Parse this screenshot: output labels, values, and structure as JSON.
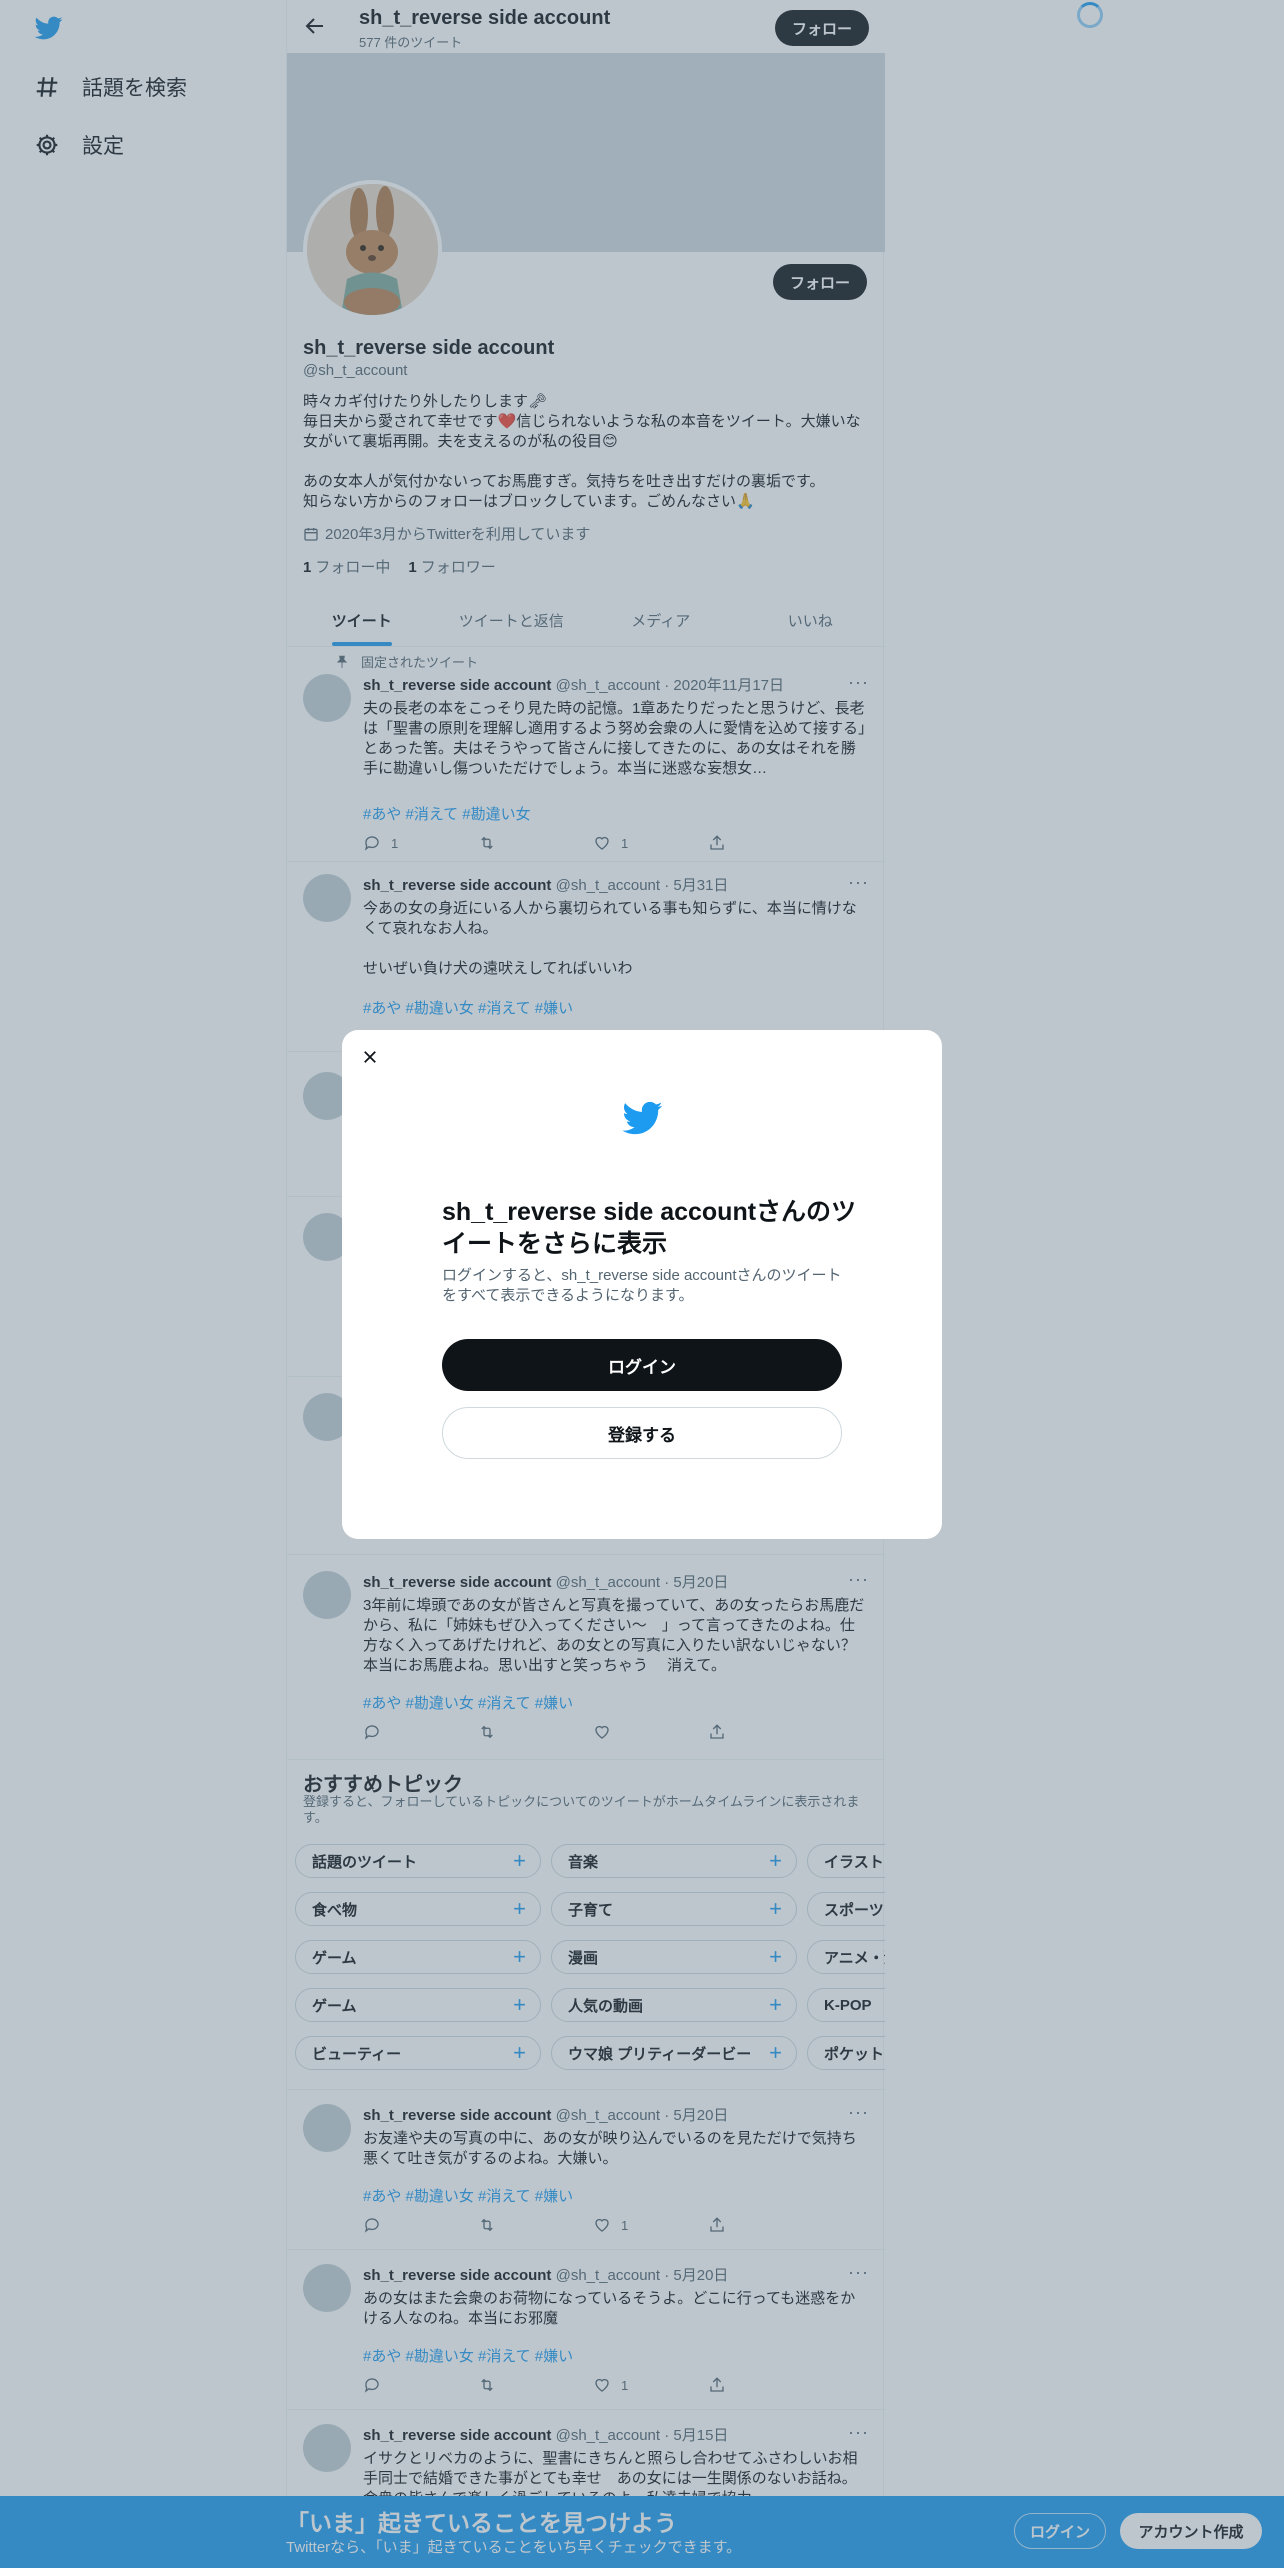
{
  "colors": {
    "brand": "#1d9bf0",
    "text": "#0f1419",
    "muted": "#536471",
    "overlay": "rgba(91,112,131,0.4)"
  },
  "leftnav": {
    "logo_icon": "twitter-bird-icon",
    "items": [
      {
        "label": "話題を検索",
        "icon": "hashtag-icon"
      },
      {
        "label": "設定",
        "icon": "gear-icon"
      }
    ]
  },
  "topbar": {
    "name": "sh_t_reverse side account",
    "count": "577 件のツイート",
    "follow": "フォロー"
  },
  "profile": {
    "follow": "フォロー",
    "name": "sh_t_reverse side account",
    "handle": "@sh_t_account",
    "bio": "時々カギ付けたり外したりします🗝\n毎日夫から愛されて幸せです❤️信じられないような私の本音をツイート。大嫌いな女がいて裏垢再開。夫を支えるのが私の役目😊\n\nあの女本人が気付かないってお馬鹿すぎ。気持ちを吐き出すだけの裏垢です。\n知らない方からのフォローはブロックしています。ごめんなさい🙏",
    "joined": "2020年3月からTwitterを利用しています",
    "following_count": "1",
    "following_label": "フォロー中",
    "followers_count": "1",
    "followers_label": "フォロワー"
  },
  "tabs": [
    "ツイート",
    "ツイートと返信",
    "メディア",
    "いいね"
  ],
  "tweets": [
    {
      "pinned_label": "固定されたツイート",
      "name": "sh_t_reverse side account",
      "handle": "@sh_t_account · 2020年11月17日",
      "text": "夫の長老の本をこっそり見た時の記憶。1章あたりだったと思うけど、長老は「聖書の原則を理解し適用するよう努め会衆の人に愛情を込めて接する」とあった筈。夫はそうやって皆さんに接してきたのに、あの女はそれを勝手に勘違いし傷ついただけでしょう。本当に迷惑な妄想女…",
      "tags": "#あや #消えて #勘違い女",
      "reply": "1",
      "retweet": "",
      "like": "1"
    },
    {
      "name": "sh_t_reverse side account",
      "handle": "@sh_t_account · 5月31日",
      "text": "今あの女の身近にいる人から裏切られている事も知らずに、本当に情けなくて哀れなお人ね。\n\nせいぜい負け犬の遠吠えしてればいいわ",
      "tags": "#あや #勘違い女 #消えて #嫌い"
    },
    {
      "name": "sh_t_reverse side account",
      "handle": "@sh_t_account · 5月20日",
      "text": "3年前に埠頭であの女が皆さんと写真を撮っていて、あの女ったらお馬鹿だから、私に「姉妹もぜひ入ってください〜　」って言ってきたのよね。仕方なく入ってあげたけれど、あの女との写真に入りたい訳ないじゃない？本当にお馬鹿よね。思い出すと笑っちゃう　 消えて。",
      "tags": "#あや #勘違い女 #消えて #嫌い",
      "reply": "",
      "retweet": "",
      "like": ""
    },
    {
      "name": "sh_t_reverse side account",
      "handle": "@sh_t_account · 5月20日",
      "text": "お友達や夫の写真の中に、あの女が映り込んでいるのを見ただけで気持ち悪くて吐き気がするのよね。大嫌い。",
      "tags": "#あや #勘違い女 #消えて #嫌い",
      "reply": "",
      "retweet": "",
      "like": "1"
    },
    {
      "name": "sh_t_reverse side account",
      "handle": "@sh_t_account · 5月20日",
      "text": "あの女はまた会衆のお荷物になっているそうよ。どこに行っても迷惑をかける人なのね。本当にお邪魔",
      "tags": "#あや #勘違い女 #消えて #嫌い",
      "reply": "",
      "retweet": "",
      "like": "1"
    },
    {
      "name": "sh_t_reverse side account",
      "handle": "@sh_t_account · 5月15日",
      "text": "イサクとリベカのように、聖書にきちんと照らし合わせてふさわしいお相手同士で結婚できた事がとても幸せ　あの女には一生関係のないお話ね。会衆の皆さんで楽しく過ごしているのよ。私達夫婦で協力"
    }
  ],
  "topics": {
    "title": "おすすめトピック",
    "desc": "登録すると、フォローしているトピックについてのツイートがホームタイムラインに表示されます。",
    "chips": [
      "話題のツイート",
      "音楽",
      "イラストレーション",
      "食べ物",
      "子育て",
      "スポーツ",
      "ゲーム",
      "漫画",
      "アニメ・漫画",
      "ゲーム",
      "人気の動画",
      "K-POP",
      "ビューティー",
      "ウマ娘 プリティーダービー",
      "ポケットモンスター"
    ]
  },
  "modal": {
    "title": "sh_t_reverse side accountさんのツイートをさらに表示",
    "desc": "ログインすると、sh_t_reverse side accountさんのツイートをすべて表示できるようになります。",
    "login": "ログイン",
    "signup": "登録する"
  },
  "bottombar": {
    "title": "「いま」起きていることを見つけよう",
    "subtitle": "Twitterなら、「いま」起きていることをいち早くチェックできます。",
    "login": "ログイン",
    "signup": "アカウント作成"
  }
}
